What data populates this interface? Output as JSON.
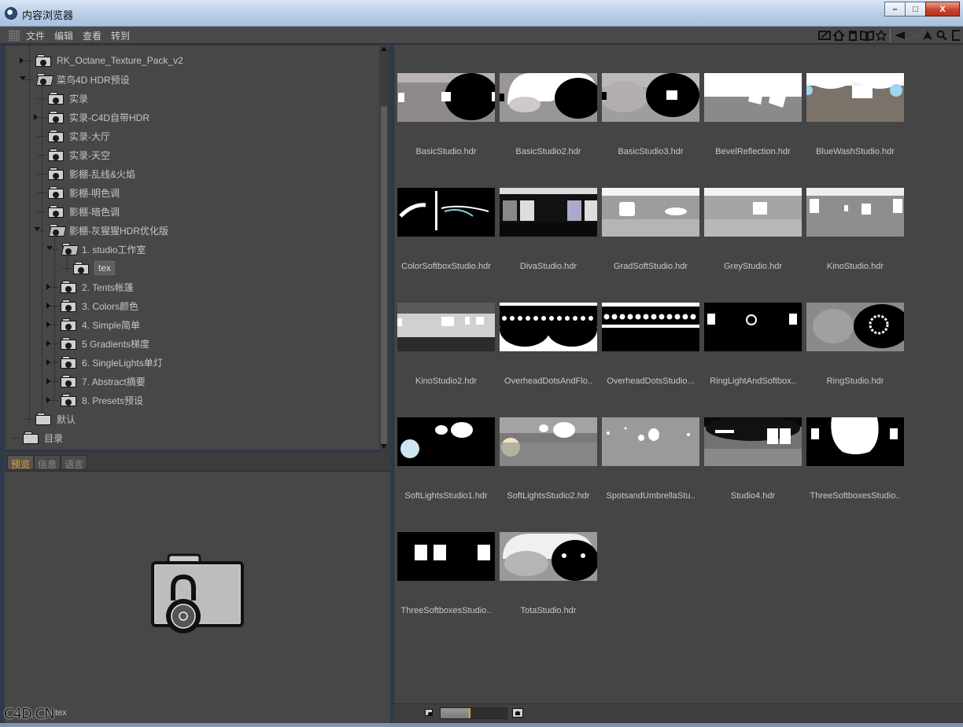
{
  "window": {
    "title": "内容浏览器",
    "minimize": "–",
    "maximize": "□",
    "close": "X"
  },
  "menu": [
    "文件",
    "编辑",
    "查看",
    "转到"
  ],
  "toolbar_icons": [
    "edit-icon",
    "home-icon",
    "trash-icon",
    "book-icon",
    "star-icon",
    "back-icon",
    "forward-icon",
    "up-icon",
    "search-icon",
    "expand-icon"
  ],
  "tree": [
    {
      "label": "RK_Octane_Texture_Pack_v2"
    },
    {
      "label": "菜鸟4D HDR预设"
    },
    {
      "label": "实录"
    },
    {
      "label": "实录-C4D自带HDR"
    },
    {
      "label": "实录-大厅"
    },
    {
      "label": "实录-天空"
    },
    {
      "label": "影棚-乱线&火焰"
    },
    {
      "label": "影棚-明色调"
    },
    {
      "label": "影棚-暗色调"
    },
    {
      "label": "影棚-灰猩猩HDR优化版"
    },
    {
      "label": "1. studio工作室"
    },
    {
      "label": "tex"
    },
    {
      "label": "2. Tents帐篷"
    },
    {
      "label": "3. Colors颜色"
    },
    {
      "label": "4. Simple简单"
    },
    {
      "label": "5 Gradients梯度"
    },
    {
      "label": "6. SingleLights单灯"
    },
    {
      "label": "7. Abstract摘要"
    },
    {
      "label": "8. Presets预设"
    },
    {
      "label": "默认"
    },
    {
      "label": "目录"
    }
  ],
  "tabs": [
    "预览",
    "信息",
    "语言"
  ],
  "preview": {
    "caption": "tex",
    "watermark": "C4D.CN"
  },
  "files": [
    "BasicStudio.hdr",
    "BasicStudio2.hdr",
    "BasicStudio3.hdr",
    "BevelReflection.hdr",
    "BlueWashStudio.hdr",
    "ColorSoftboxStudio.hdr",
    "DivaStudio.hdr",
    "GradSoftStudio.hdr",
    "GreyStudio.hdr",
    "KinoStudio.hdr",
    "KinoStudio2.hdr",
    "OverheadDotsAndFlo..",
    "OverheadDotsStudio...",
    "RingLightAndSoftbox..",
    "RingStudio.hdr",
    "SoftLightsStudio1.hdr",
    "SoftLightsStudio2.hdr",
    "SpotsandUmbrellaStu..",
    "Studio4.hdr",
    "ThreeSoftboxesStudio..",
    "ThreeSoftboxesStudio..",
    "TotaStudio.hdr"
  ],
  "zoom": {
    "fraction": 0.44
  }
}
